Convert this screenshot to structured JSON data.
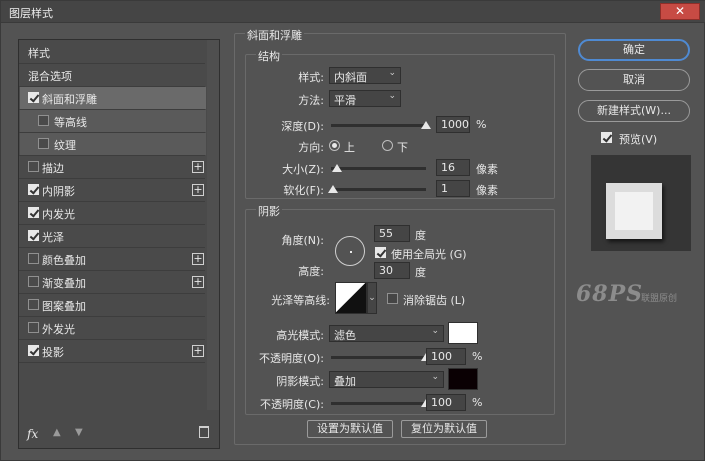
{
  "window": {
    "title": "图层样式",
    "close_icon": "close-icon"
  },
  "left_panel": {
    "items": [
      {
        "label": "样式",
        "checkbox": false,
        "has_checkbox": false,
        "plus": false
      },
      {
        "label": "混合选项",
        "checkbox": false,
        "has_checkbox": false,
        "plus": false
      },
      {
        "label": "斜面和浮雕",
        "checkbox": true,
        "has_checkbox": true,
        "plus": false,
        "active": true
      },
      {
        "label": "等高线",
        "checkbox": false,
        "has_checkbox": true,
        "plus": false,
        "sub": true
      },
      {
        "label": "纹理",
        "checkbox": false,
        "has_checkbox": true,
        "plus": false,
        "sub": true
      },
      {
        "label": "描边",
        "checkbox": false,
        "has_checkbox": true,
        "plus": true
      },
      {
        "label": "内阴影",
        "checkbox": true,
        "has_checkbox": true,
        "plus": true
      },
      {
        "label": "内发光",
        "checkbox": true,
        "has_checkbox": true,
        "plus": false
      },
      {
        "label": "光泽",
        "checkbox": true,
        "has_checkbox": true,
        "plus": false
      },
      {
        "label": "颜色叠加",
        "checkbox": false,
        "has_checkbox": true,
        "plus": true
      },
      {
        "label": "渐变叠加",
        "checkbox": false,
        "has_checkbox": true,
        "plus": true
      },
      {
        "label": "图案叠加",
        "checkbox": false,
        "has_checkbox": true,
        "plus": false
      },
      {
        "label": "外发光",
        "checkbox": false,
        "has_checkbox": true,
        "plus": false
      },
      {
        "label": "投影",
        "checkbox": true,
        "has_checkbox": true,
        "plus": true
      }
    ],
    "bottom": {
      "fx": "fx",
      "icons": [
        "up-arrow-icon",
        "down-arrow-icon",
        "trash-icon"
      ]
    }
  },
  "bevel": {
    "group_title": "斜面和浮雕",
    "structure_title": "结构",
    "style_label": "样式:",
    "style_value": "内斜面",
    "technique_label": "方法:",
    "technique_value": "平滑",
    "depth_label": "深度(D):",
    "depth_value": "1000",
    "depth_unit": "%",
    "depth_level": 1.0,
    "direction_label": "方向:",
    "direction_up": "上",
    "direction_down": "下",
    "direction_selected": "上",
    "size_label": "大小(Z):",
    "size_value": "16",
    "size_unit": "像素",
    "size_level": 0.06,
    "soften_label": "软化(F):",
    "soften_value": "1",
    "soften_unit": "像素",
    "soften_level": 0.02
  },
  "shading": {
    "title": "阴影",
    "angle_label": "角度(N):",
    "angle_value": "55",
    "angle_unit": "度",
    "global_light_label": "使用全局光 (G)",
    "global_light_checked": true,
    "altitude_label": "高度:",
    "altitude_value": "30",
    "altitude_unit": "度",
    "gloss_contour_label": "光泽等高线:",
    "antialias_label": "消除锯齿 (L)",
    "antialias_checked": false,
    "highlight_mode_label": "高光模式:",
    "highlight_mode_value": "滤色",
    "highlight_color": "#ffffff",
    "highlight_opacity_label": "不透明度(O):",
    "highlight_opacity_value": "100",
    "highlight_opacity_unit": "%",
    "highlight_opacity_level": 1.0,
    "shadow_mode_label": "阴影模式:",
    "shadow_mode_value": "叠加",
    "shadow_color": "#0a0003",
    "shadow_opacity_label": "不透明度(C):",
    "shadow_opacity_value": "100",
    "shadow_opacity_unit": "%",
    "shadow_opacity_level": 1.0
  },
  "footer": {
    "make_default": "设置为默认值",
    "reset_default": "复位为默认值"
  },
  "right": {
    "ok": "确定",
    "cancel": "取消",
    "new_style": "新建样式(W)...",
    "preview_label": "预览(V)",
    "preview_checked": true,
    "watermark": "68PS",
    "watermark_sub": "联盟原创"
  }
}
